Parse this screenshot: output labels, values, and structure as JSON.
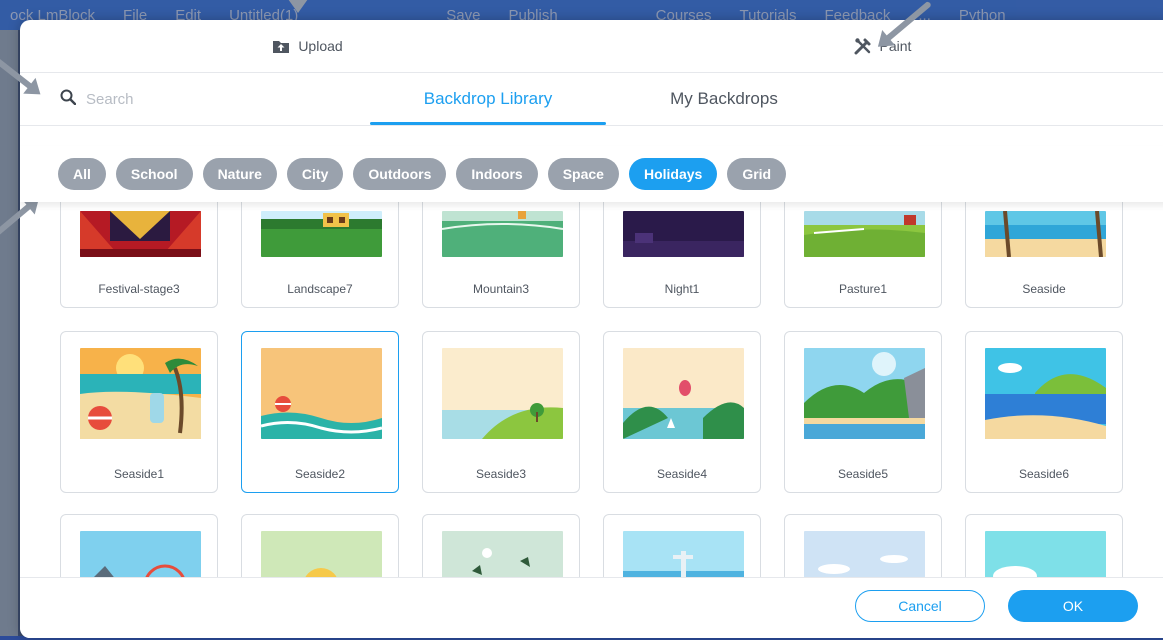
{
  "background": {
    "items": [
      "ock  LmBlock",
      "File",
      "Edit",
      "Untitled(1)",
      "Save",
      "Publish",
      "Courses",
      "Tutorials",
      "Feedback",
      "...",
      "Python"
    ]
  },
  "modal": {
    "upload_label": "Upload",
    "paint_label": "Paint",
    "search_placeholder": "Search",
    "tabs": [
      {
        "label": "Backdrop Library",
        "active": true
      },
      {
        "label": "My Backdrops",
        "active": false
      }
    ],
    "categories": [
      {
        "label": "All",
        "active": false
      },
      {
        "label": "School",
        "active": false
      },
      {
        "label": "Nature",
        "active": false
      },
      {
        "label": "City",
        "active": false
      },
      {
        "label": "Outdoors",
        "active": false
      },
      {
        "label": "Indoors",
        "active": false
      },
      {
        "label": "Space",
        "active": false
      },
      {
        "label": "Holidays",
        "active": true
      },
      {
        "label": "Grid",
        "active": false
      }
    ],
    "backdrops_row1": [
      "Festival-stage3",
      "Landscape7",
      "Mountain3",
      "Night1",
      "Pasture1",
      "Seaside"
    ],
    "backdrops_row2": [
      "Seaside1",
      "Seaside2",
      "Seaside3",
      "Seaside4",
      "Seaside5",
      "Seaside6"
    ],
    "selected": "Seaside2",
    "cancel_label": "Cancel",
    "ok_label": "OK"
  },
  "colors": {
    "accent": "#1c9ff0",
    "chip_inactive": "#9aa2ad"
  }
}
